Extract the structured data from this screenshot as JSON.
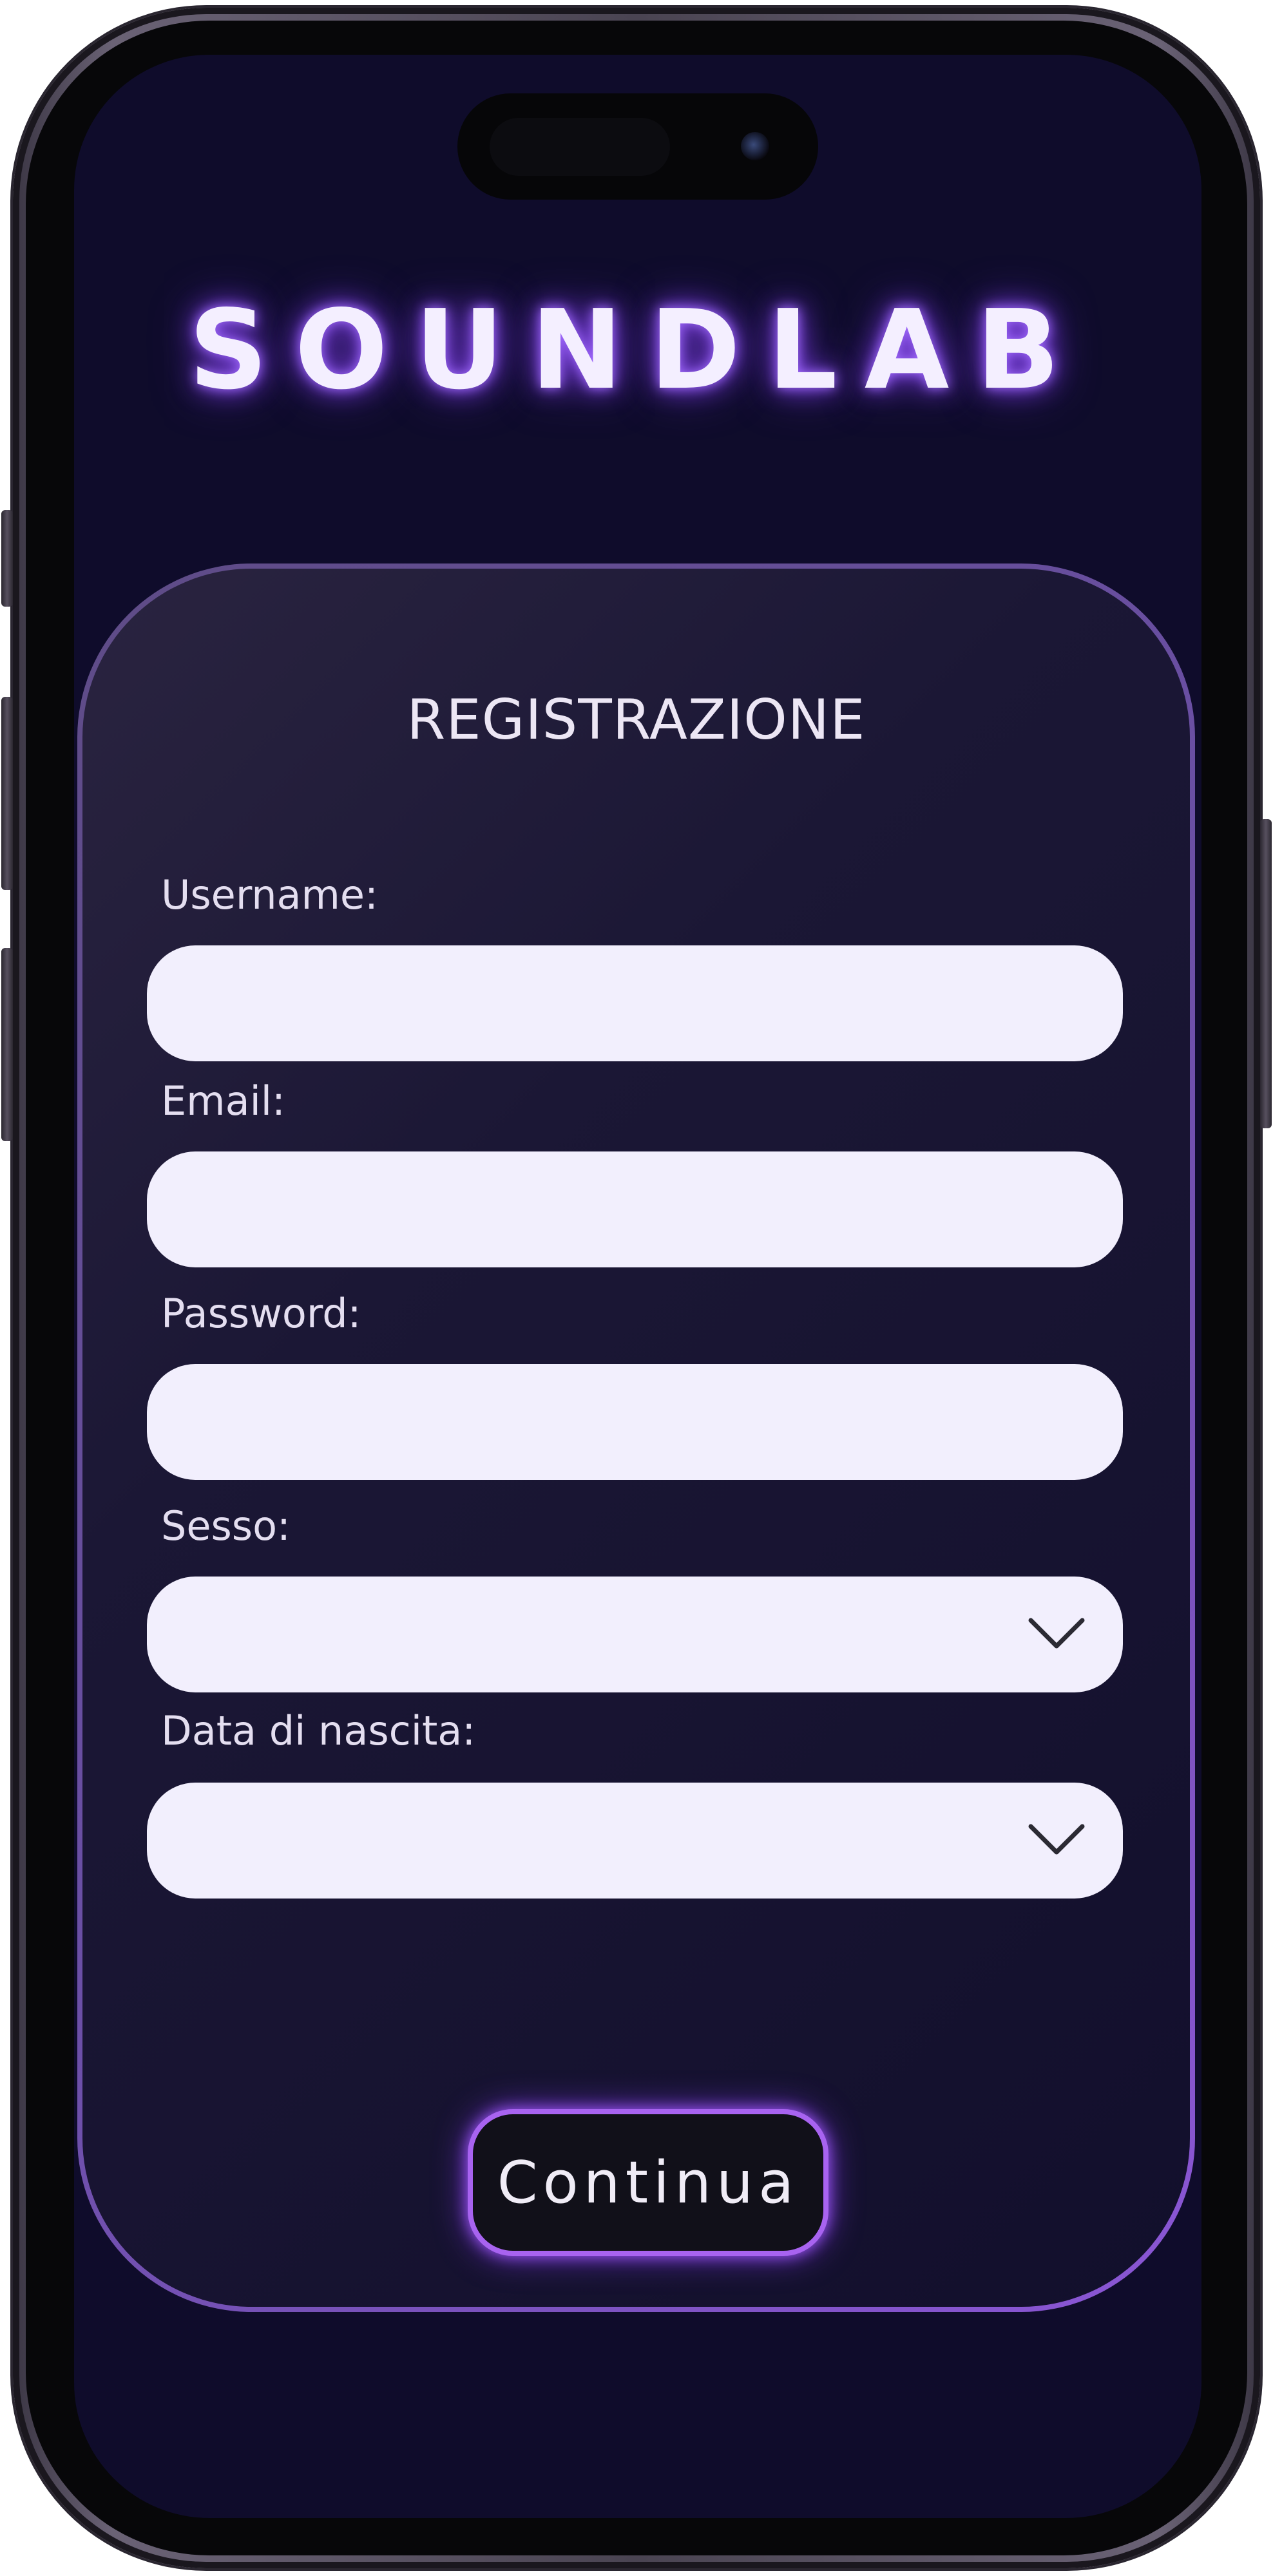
{
  "app": {
    "logo": "SOUNDLAB"
  },
  "form": {
    "title": "REGISTRAZIONE",
    "fields": [
      {
        "label": "Username:",
        "value": "",
        "type": "text"
      },
      {
        "label": "Email:",
        "value": "",
        "type": "text"
      },
      {
        "label": "Password:",
        "value": "",
        "type": "password"
      },
      {
        "label": "Sesso:",
        "value": "",
        "type": "select"
      },
      {
        "label": "Data di nascita:",
        "value": "",
        "type": "select"
      }
    ],
    "submit_label": "Continua"
  },
  "icons": {
    "dropdown": "chevron-down-icon"
  },
  "colors": {
    "background": "#0f0c2b",
    "accent": "#a863f0",
    "input_fill": "#f2effd",
    "text": "#ece6f4"
  }
}
